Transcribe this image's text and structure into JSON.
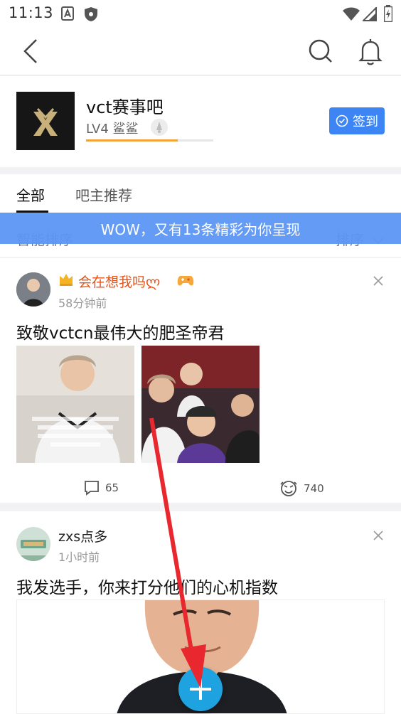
{
  "status_bar": {
    "time": "11:13"
  },
  "forum": {
    "name": "vct赛事吧",
    "level": "LV4 鲨鲨",
    "xp_progress": 0.72,
    "checkin_label": "签到"
  },
  "tabs": [
    {
      "label": "全部",
      "active": true
    },
    {
      "label": "吧主推荐",
      "active": false
    }
  ],
  "sort": {
    "left_label": "智能排序",
    "right_label": "排序"
  },
  "banner_text": "WOW，又有13条精彩为你呈现",
  "posts": [
    {
      "username": "会在想我吗ლ",
      "time": "58分钟前",
      "title": "致敬vctcn最伟大的肥圣帝君",
      "comments": "65",
      "likes": "740"
    },
    {
      "username": "zxs点多",
      "time": "1小时前",
      "title": "我发选手，你来打分他们的心机指数"
    }
  ],
  "colors": {
    "accent": "#3d85f5",
    "fab": "#1ea3e0",
    "banner": "#5c96f4",
    "arrow": "#e8282e",
    "username_vip": "#e4531a"
  }
}
